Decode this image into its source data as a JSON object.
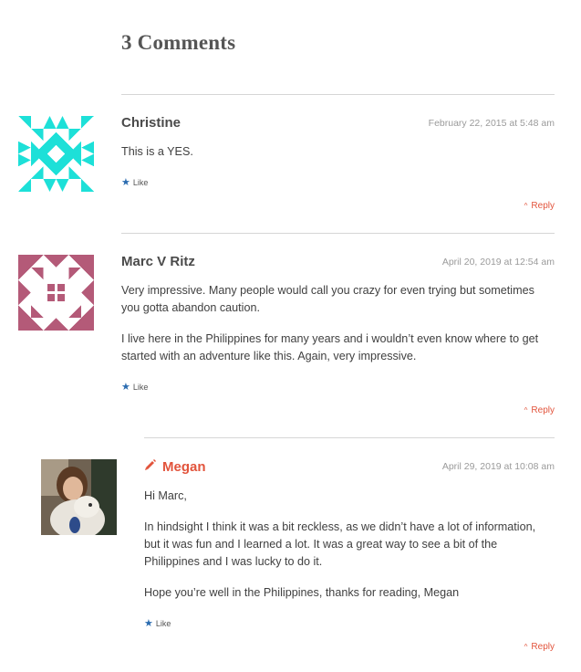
{
  "heading": "3 Comments",
  "colors": {
    "accent": "#e2543c",
    "gravatar1": "#1de0d8",
    "gravatar2": "#b45a78"
  },
  "comments": [
    {
      "author": "Christine",
      "date": "February 22, 2015 at 5:48 am",
      "paragraphs": [
        "This is a YES."
      ],
      "like": "Like",
      "reply": "Reply"
    },
    {
      "author": "Marc V Ritz",
      "date": "April 20, 2019 at 12:54 am",
      "paragraphs": [
        "Very impressive. Many people would call you crazy for even trying but sometimes you gotta abandon caution.",
        "I live here in the Philippines for many years and i wouldn’t even know where to get started with an adventure like this. Again, very impressive."
      ],
      "like": "Like",
      "reply": "Reply"
    },
    {
      "author": "Megan",
      "author_icon": "pencil-icon",
      "date": "April 29, 2019 at 10:08 am",
      "paragraphs": [
        "Hi Marc,",
        "In hindsight I think it was a bit reckless, as we didn’t have a lot of information, but it was fun and I learned a lot. It was a great way to see a bit of the Philippines and I was lucky to do it.",
        "Hope you’re well in the Philippines, thanks for reading, Megan"
      ],
      "like": "Like",
      "reply": "Reply"
    }
  ]
}
